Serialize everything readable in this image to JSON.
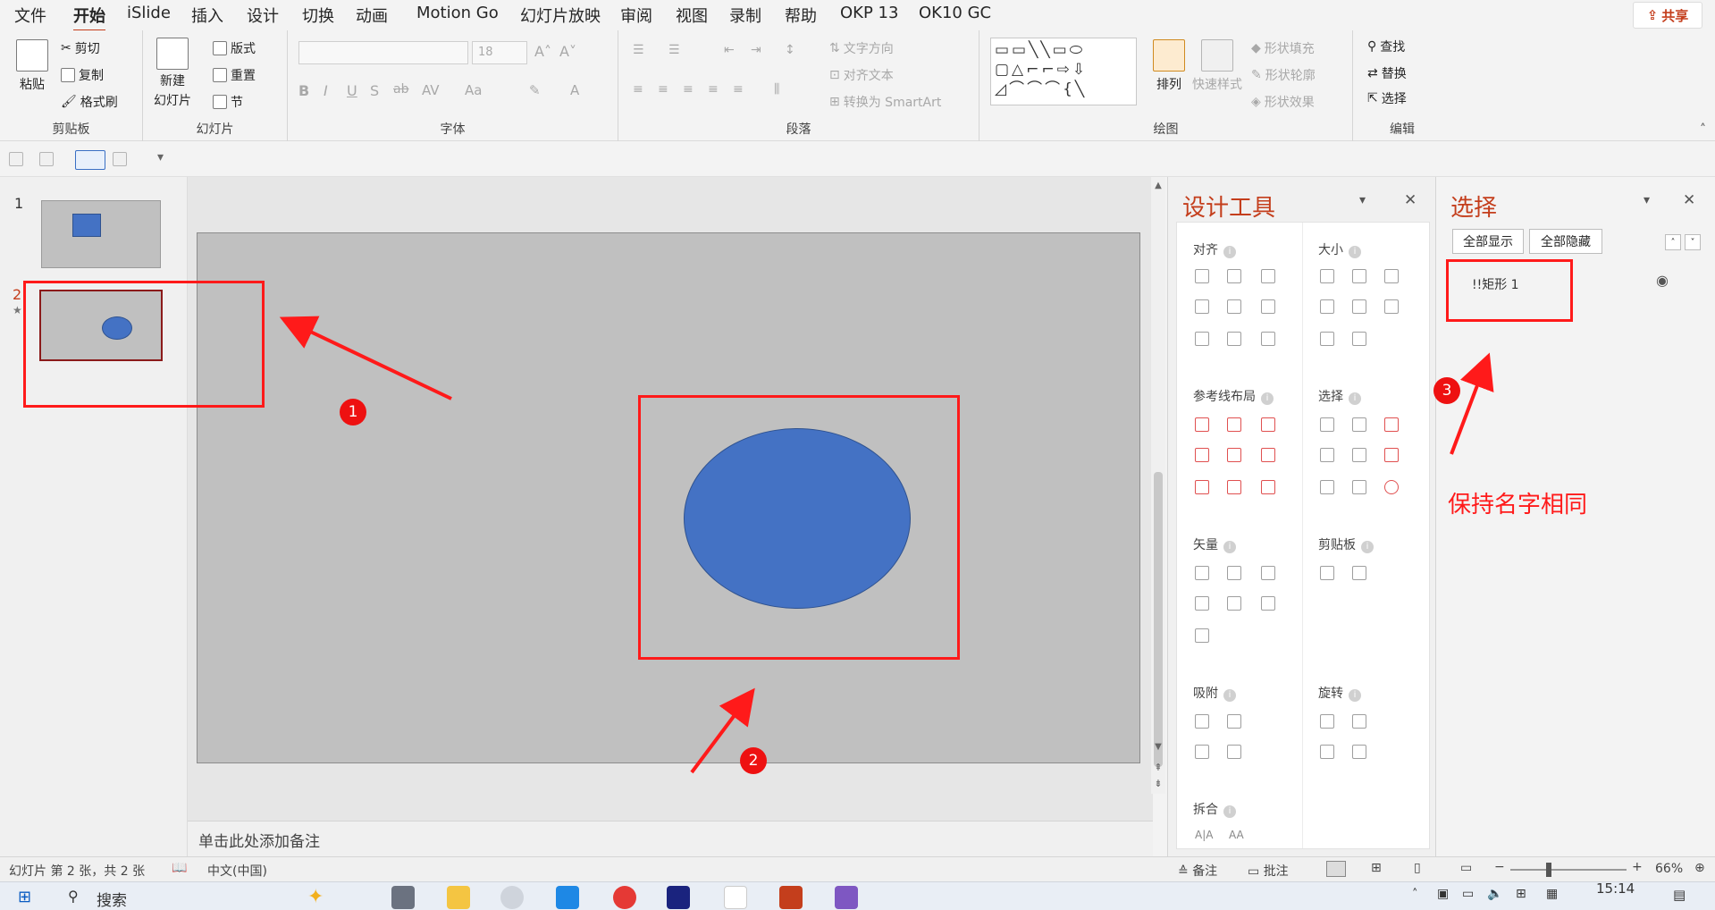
{
  "tabs": [
    "文件",
    "开始",
    "iSlide",
    "插入",
    "设计",
    "切换",
    "动画",
    "Motion Go",
    "幻灯片放映",
    "审阅",
    "视图",
    "录制",
    "帮助",
    "OKP 13",
    "OK10 GC"
  ],
  "active_tab": "开始",
  "share_label": "共享",
  "ribbon": {
    "clipboard": {
      "paste": "粘贴",
      "cut": "剪切",
      "copy": "复制",
      "format_painter": "格式刷",
      "label": "剪贴板"
    },
    "slides": {
      "new_slide_line1": "新建",
      "new_slide_line2": "幻灯片",
      "layout": "版式",
      "reset": "重置",
      "section": "节",
      "label": "幻灯片"
    },
    "font": {
      "size": "18",
      "label": "字体",
      "bold": "B",
      "italic": "I",
      "underline": "U",
      "shadow": "S",
      "strike": "ab"
    },
    "paragraph": {
      "text_direction": "文字方向",
      "align_text": "对齐文本",
      "convert_smartart": "转换为 SmartArt",
      "label": "段落"
    },
    "drawing": {
      "arrange": "排列",
      "quick_styles": "快速样式",
      "shape_fill": "形状填充",
      "shape_outline": "形状轮廓",
      "shape_effects": "形状效果",
      "label": "绘图"
    },
    "editing": {
      "find": "查找",
      "replace": "替换",
      "select": "选择",
      "label": "编辑"
    }
  },
  "thumbnails": [
    {
      "number": "1"
    },
    {
      "number": "2"
    }
  ],
  "notes_placeholder": "单击此处添加备注",
  "design_panel": {
    "title": "设计工具",
    "sections": {
      "align": "对齐",
      "size": "大小",
      "guide_layout": "参考线布局",
      "select": "选择",
      "vector": "矢量",
      "clipboard": "剪贴板",
      "snap": "吸附",
      "rotate": "旋转",
      "split": "拆合"
    },
    "split_items": [
      "A|A",
      "AA"
    ]
  },
  "selection_panel": {
    "title": "选择",
    "show_all": "全部显示",
    "hide_all": "全部隐藏",
    "items": [
      {
        "name": "!!矩形 1"
      }
    ]
  },
  "annotations": {
    "note": "保持名字相同",
    "markers": [
      "1",
      "2",
      "3"
    ]
  },
  "status": {
    "slide_info": "幻灯片 第 2 张，共 2 张",
    "language": "中文(中国)",
    "notes": "备注",
    "comments": "批注",
    "zoom": "66%"
  },
  "taskbar": {
    "search": "搜索",
    "time": "15:14"
  },
  "colors": {
    "accent": "#c43e1c",
    "shape_fill": "#4472c4",
    "slide_bg": "#c0c0c0",
    "annotation_red": "#ff1a1a"
  }
}
